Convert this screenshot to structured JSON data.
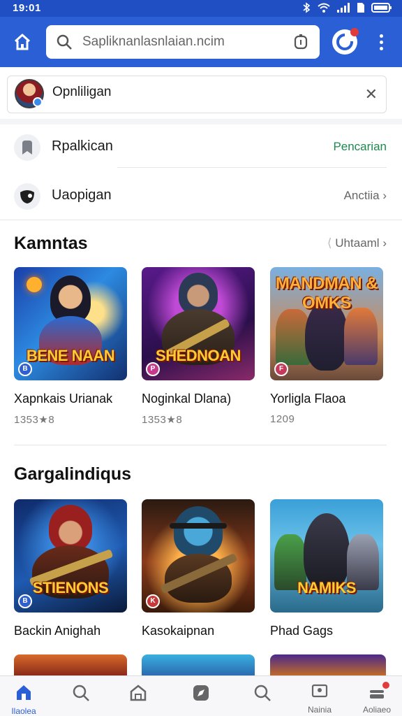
{
  "status_bar": {
    "time": "19:01"
  },
  "browser": {
    "url": "Sapliknanlasnlaian.ncim",
    "icons": [
      "home-icon",
      "search-icon",
      "shield-icon",
      "extension-icon",
      "more-vert-icon"
    ]
  },
  "account": {
    "name": "Opnliligan"
  },
  "menu_rows": [
    {
      "label": "Rpalkican",
      "action": "Pencarian",
      "icon": "bookmark-icon"
    },
    {
      "label": "Uaopigan",
      "action": "Anctiia",
      "icon": "mask-icon"
    }
  ],
  "section1": {
    "title": "Kamntas",
    "more": "Uhtaaml",
    "games": [
      {
        "name": "Xapnkais Urianak",
        "rating": "1353★8",
        "art_title": "BENE NAAN"
      },
      {
        "name": "Noginkal Dlana)",
        "rating": "1353★8",
        "art_title": "SHEDNOAN"
      },
      {
        "name": "Yorligla Flaoa",
        "rating": "1209",
        "art_title": "MANDMAN & OMKS"
      }
    ]
  },
  "section2": {
    "title": "Gargalindiqus",
    "games": [
      {
        "name": "Backin Anighah",
        "art_title": "STIENONS"
      },
      {
        "name": "Kasokaipnan",
        "art_title": ""
      },
      {
        "name": "Phad Gags",
        "art_title": "NAMIKS"
      }
    ]
  },
  "bottom_nav": [
    {
      "label": "Ilaolea",
      "icon": "home-icon",
      "active": true
    },
    {
      "label": "",
      "icon": "search-icon"
    },
    {
      "label": "",
      "icon": "store-icon"
    },
    {
      "label": "",
      "icon": "compass-icon"
    },
    {
      "label": "",
      "icon": "search-icon"
    },
    {
      "label": "Nainia",
      "icon": "library-icon"
    },
    {
      "label": "Aoliaeo",
      "icon": "account-icon"
    }
  ],
  "colors": {
    "primary": "#2a5fd6",
    "accent_green": "#1c8a4e",
    "badge_red": "#e23b3b"
  }
}
